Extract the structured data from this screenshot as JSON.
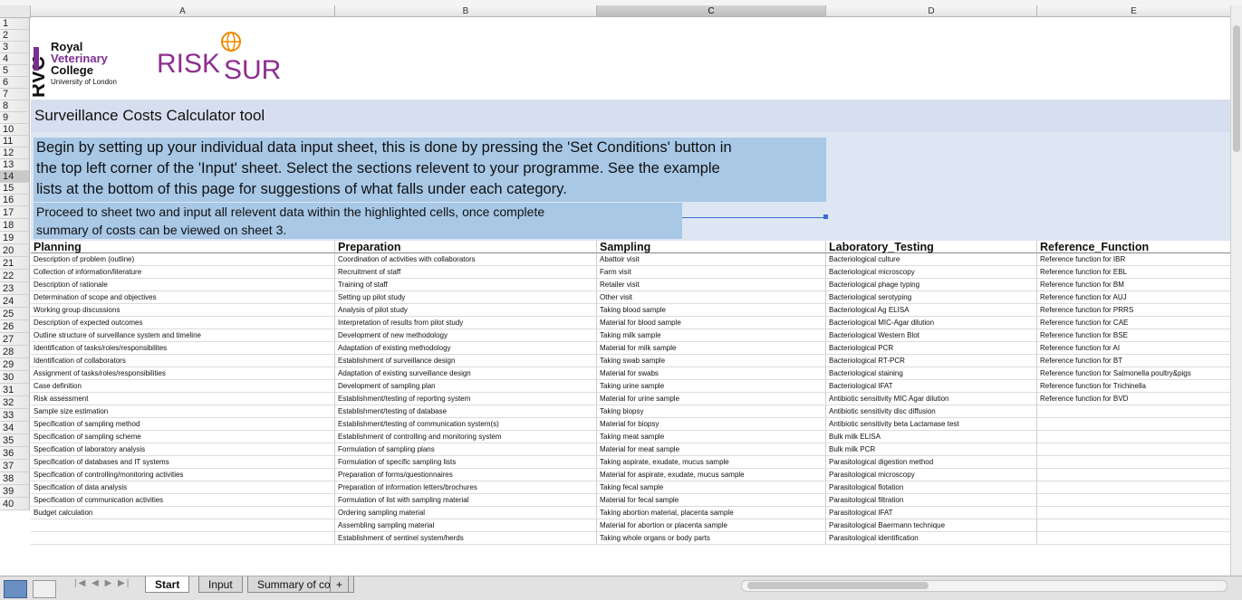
{
  "columns": [
    "A",
    "B",
    "C",
    "D",
    "E"
  ],
  "selected_column": "C",
  "row_numbers": [
    "1",
    "2",
    "3",
    "4",
    "5",
    "6",
    "7",
    "8",
    "9",
    "10",
    "11",
    "12",
    "13",
    "14",
    "15",
    "16",
    "17",
    "18",
    "19",
    "20",
    "21",
    "22",
    "23",
    "24",
    "25",
    "26",
    "27",
    "28",
    "29",
    "30",
    "31",
    "32",
    "33",
    "34",
    "35",
    "36",
    "37",
    "38",
    "39",
    "40"
  ],
  "selected_row": "14",
  "logo": {
    "rvc_letters": "RVC",
    "line1": "Royal",
    "line2": "Veterinary",
    "line3": "College",
    "line4": "University of London",
    "risksur_left": "RISK",
    "risksur_right": "SUR"
  },
  "title": "Surveillance Costs Calculator tool",
  "instructions": {
    "paragraph1_line1": "Begin by setting up your individual data input sheet, this is done by pressing the 'Set Conditions' button in",
    "paragraph1_line2": "the top left corner of the 'Input' sheet. Select the sections relevent to your programme. See the example",
    "paragraph1_line3": "lists at the bottom of this page for suggestions of what falls under each category.",
    "paragraph2_line1": "Proceed to sheet two and input all relevent data within the highlighted cells, once complete",
    "paragraph2_line2": "summary of costs can be viewed on sheet 3."
  },
  "table_headers": [
    "Planning",
    "Preparation",
    "Sampling",
    "Laboratory_Testing",
    "Reference_Function"
  ],
  "table_rows": [
    [
      "Description of problem (outline)",
      "Coordination of activities with collaborators",
      "Abattoir visit",
      "Bacteriological culture",
      "Reference function for IBR"
    ],
    [
      "Collection of information/literature",
      "Recruitment of staff",
      "Farm visit",
      "Bacteriological microscopy",
      "Reference function for EBL"
    ],
    [
      "Description of rationale",
      "Training of staff",
      "Retailer visit",
      "Bacteriological phage typing",
      "Reference function for BM"
    ],
    [
      "Determination of scope and objectives",
      "Setting up pilot study",
      "Other visit",
      "Bacteriological serotyping",
      "Reference function for AUJ"
    ],
    [
      "Working group discussions",
      "Analysis of pilot study",
      "Taking blood sample",
      "Bacteriological Ag ELISA",
      "Reference function for PRRS"
    ],
    [
      "Description of expected outcomes",
      "Interpretation of results from pilot study",
      "Material for blood sample",
      "Bacteriological MIC-Agar dilution",
      "Reference function for CAE"
    ],
    [
      "Outline structure of surveillance system and timeline",
      "Development of new methodology",
      "Taking milk sample",
      "Bacteriological Western Blot",
      "Reference function for BSE"
    ],
    [
      "Identification of tasks/roles/responsibilites",
      "Adaptation of existing methodology",
      "Material for milk sample",
      "Bacteriological PCR",
      "Reference function for AI"
    ],
    [
      "Identification of collaborators",
      "Establishment of surveillance design",
      "Taking swab sample",
      "Bacteriological RT-PCR",
      "Reference function for BT"
    ],
    [
      "Assignment of tasks/roles/responsibilities",
      "Adaptation of existing surveillance design",
      "Material for swabs",
      "Bacteriological staining",
      "Reference function for Salmonella poultry&pigs"
    ],
    [
      "Case definition",
      "Development of sampling plan",
      "Taking urine sample",
      "Bacteriological IFAT",
      "Reference function for Trichinella"
    ],
    [
      "Risk assessment",
      "Establishment/testing of reporting system",
      "Material for urine sample",
      "Antibiotic sensitivity MIC Agar dilution",
      "Reference function for BVD"
    ],
    [
      "Sample size estimation",
      "Establishment/testing of database",
      "Taking biopsy",
      "Antibiotic sensitivity disc diffusion",
      ""
    ],
    [
      "Specification of sampling method",
      "Establishment/testing of communication system(s)",
      "Material for biopsy",
      "Antibiotic sensitivity beta Lactamase test",
      ""
    ],
    [
      "Specification of sampling scheme",
      "Establishment of controlling and monitoring system",
      "Taking meat sample",
      "Bulk milk ELISA",
      ""
    ],
    [
      "Specification of laboratory analysis",
      "Formulation of sampling plans",
      "Material for meat sample",
      "Bulk milk PCR",
      ""
    ],
    [
      "Specification of databases and IT systems",
      "Formulation of specific sampling lists",
      "Taking aspirate, exudate, mucus sample",
      "Parasitological digestion method",
      ""
    ],
    [
      "Specification of controlling/monitoring activities",
      "Preparation of forms/questionnaires",
      "Material for aspirate, exudate, mucus sample",
      "Parasitological microscopy",
      ""
    ],
    [
      "Specification of data analysis",
      "Preparation of information letters/brochures",
      "Taking fecal sample",
      "Parasitological flotation",
      ""
    ],
    [
      "Specification of communication activities",
      "Formulation of list with sampling material",
      "Material for fecal sample",
      "Parasitological filtration",
      ""
    ],
    [
      "Budget calculation",
      "Ordering sampling material",
      "Taking abortion material, placenta sample",
      "Parasitological IFAT",
      ""
    ],
    [
      "",
      "Assembling sampling material",
      "Material for abortion or placenta sample",
      "Parasitological Baermann technique",
      ""
    ],
    [
      "",
      "Establishment of sentinel system/herds",
      "Taking whole organs or body parts",
      "Parasitological identification",
      ""
    ]
  ],
  "sheet_tabs": [
    "Start",
    "Input",
    "Summary of costs"
  ],
  "active_tab": "Start",
  "add_sheet_label": "+",
  "nav_arrows": [
    "|◀",
    "◀",
    "▶",
    "▶|"
  ],
  "colors": {
    "band": "#d7deef",
    "note": "#a8c8e6",
    "rvc_purple": "#7b2f8f",
    "risksur_purple": "#8e2f8f",
    "risksur_orange": "#f08a00"
  }
}
